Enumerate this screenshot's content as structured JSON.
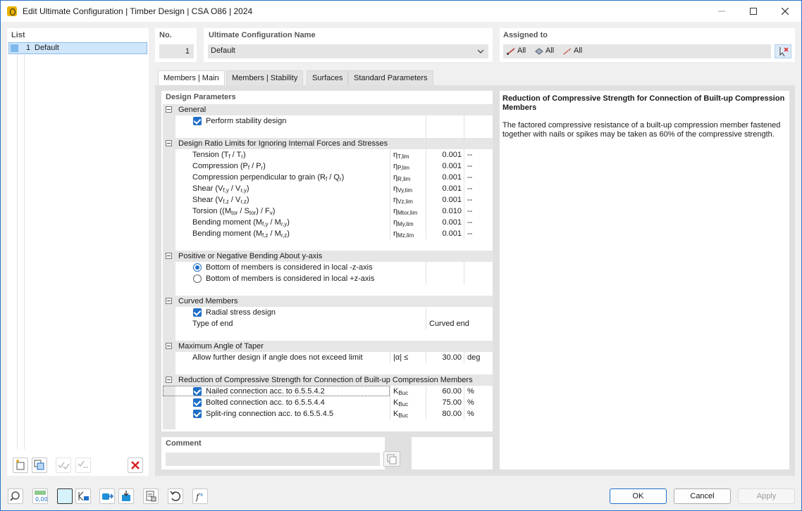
{
  "window": {
    "title": "Edit Ultimate Configuration | Timber Design | CSA O86 | 2024"
  },
  "list": {
    "header": "List",
    "items": [
      {
        "no": "1",
        "name": "Default"
      }
    ]
  },
  "no": {
    "label": "No.",
    "value": "1"
  },
  "config_name": {
    "label": "Ultimate Configuration Name",
    "value": "Default"
  },
  "assigned": {
    "label": "Assigned to",
    "items": [
      "All",
      "All",
      "All"
    ]
  },
  "tabs": [
    "Members | Main",
    "Members | Stability",
    "Surfaces",
    "Standard Parameters"
  ],
  "design": {
    "header": "Design Parameters",
    "general": {
      "title": "General",
      "perform_stability": "Perform stability design"
    },
    "ratio": {
      "title": "Design Ratio Limits for Ignoring Internal Forces and Stresses",
      "rows": [
        {
          "label": "Tension (Tf / Tr)",
          "sym": "ηT,lim",
          "value": "0.001",
          "unit": "--"
        },
        {
          "label": "Compression (Pf / Pr)",
          "sym": "ηP,lim",
          "value": "0.001",
          "unit": "--"
        },
        {
          "label": "Compression perpendicular to grain (Rf / Qr)",
          "sym": "ηR,lim",
          "value": "0.001",
          "unit": "--"
        },
        {
          "label": "Shear (Vf,y / Vr,y)",
          "sym": "ηVy,lim",
          "value": "0.001",
          "unit": "--"
        },
        {
          "label": "Shear (Vf,z / Vr,z)",
          "sym": "ηVz,lim",
          "value": "0.001",
          "unit": "--"
        },
        {
          "label": "Torsion ((Mtor / Stor) / Fv)",
          "sym": "ηMtor,lim",
          "value": "0.010",
          "unit": "--"
        },
        {
          "label": "Bending moment (Mf,y / Mr,y)",
          "sym": "ηMy,lim",
          "value": "0.001",
          "unit": "--"
        },
        {
          "label": "Bending moment (Mf,z / Mr,z)",
          "sym": "ηMz,lim",
          "value": "0.001",
          "unit": "--"
        }
      ]
    },
    "bending": {
      "title": "Positive or Negative Bending About y-axis",
      "opt1": "Bottom of members is considered in local -z-axis",
      "opt2": "Bottom of members is considered in local +z-axis"
    },
    "curved": {
      "title": "Curved Members",
      "radial": "Radial stress design",
      "type_label": "Type of end",
      "type_value": "Curved end"
    },
    "taper": {
      "title": "Maximum Angle of Taper",
      "label": "Allow further design if angle does not exceed limit",
      "sym": "|α| ≤",
      "value": "30.00",
      "unit": "deg"
    },
    "reduction": {
      "title": "Reduction of Compressive Strength for Connection of Built-up Compression Members",
      "rows": [
        {
          "label": "Nailed connection acc. to 6.5.5.4.2",
          "sym": "KBuc",
          "value": "60.00",
          "unit": "%"
        },
        {
          "label": "Bolted connection acc. to 6.5.5.4.4",
          "sym": "KBuc",
          "value": "75.00",
          "unit": "%"
        },
        {
          "label": "Split-ring connection acc. to 6.5.5.4.5",
          "sym": "KBuc",
          "value": "80.00",
          "unit": "%"
        }
      ]
    }
  },
  "info": {
    "title": "Reduction of Compressive Strength for Connection of Built-up Compression Members",
    "body": "The factored compressive resistance of a built-up compression member fastened together with nails or spikes may be taken as 60% of the compressive strength."
  },
  "comment": {
    "label": "Comment",
    "value": ""
  },
  "buttons": {
    "ok": "OK",
    "cancel": "Cancel",
    "apply": "Apply"
  },
  "colors": {
    "accent": "#1f6fc8",
    "delete": "#d81e1e"
  }
}
